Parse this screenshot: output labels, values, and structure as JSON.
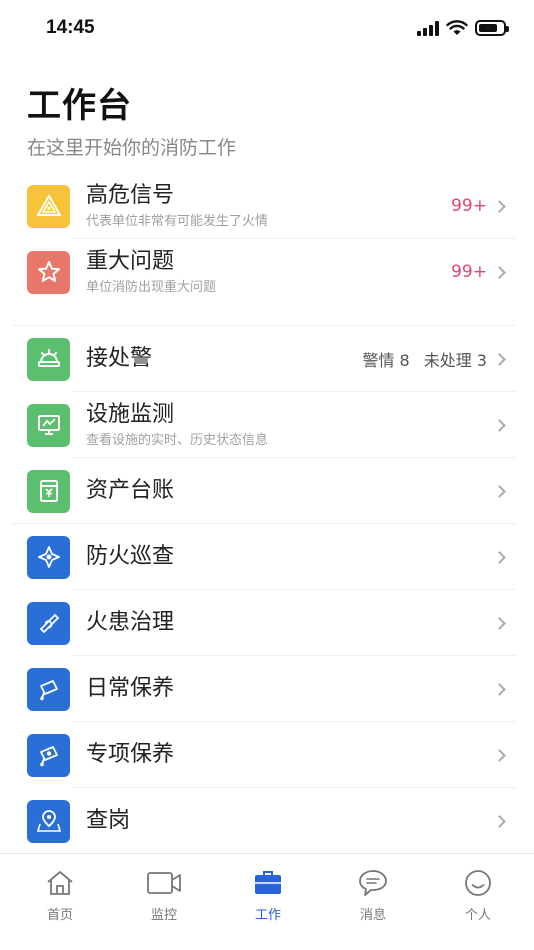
{
  "status_bar": {
    "time": "14:45"
  },
  "header": {
    "title": "工作台",
    "subtitle": "在这里开始你的消防工作"
  },
  "alerts": [
    {
      "label": "高危信号",
      "desc": "代表单位非常有可能发生了火情",
      "count": "99+",
      "icon": "warning-triangle-icon",
      "color": "#f7c33b"
    },
    {
      "label": "重大问题",
      "desc": "单位消防出现重大问题",
      "count": "99+",
      "icon": "star-icon",
      "color": "#e8776a"
    }
  ],
  "menu": [
    {
      "label": "接处警",
      "desc": "",
      "meta_a": "警情 8",
      "meta_b": "未处理 3",
      "icon": "alarm-bell-icon",
      "color": "#5bbf6f"
    },
    {
      "label": "设施监测",
      "desc": "查看设施的实时、历史状态信息",
      "icon": "monitor-icon",
      "color": "#5bbf6f"
    },
    {
      "label": "资产台账",
      "desc": "",
      "icon": "ledger-icon",
      "color": "#5bbf6f"
    },
    {
      "label": "防火巡查",
      "desc": "",
      "icon": "patrol-icon",
      "color": "#2a6fd6"
    },
    {
      "label": "火患治理",
      "desc": "",
      "icon": "fire-hazard-icon",
      "color": "#2a6fd6"
    },
    {
      "label": "日常保养",
      "desc": "",
      "icon": "daily-maintenance-icon",
      "color": "#2a6fd6"
    },
    {
      "label": "专项保养",
      "desc": "",
      "icon": "special-maintenance-icon",
      "color": "#2a6fd6"
    },
    {
      "label": "查岗",
      "desc": "",
      "icon": "map-pin-icon",
      "color": "#2a6fd6"
    }
  ],
  "tabbar": {
    "tabs": [
      {
        "label": "首页",
        "icon": "home-icon"
      },
      {
        "label": "监控",
        "icon": "video-camera-icon"
      },
      {
        "label": "工作",
        "icon": "briefcase-icon",
        "active": true
      },
      {
        "label": "消息",
        "icon": "chat-bubble-icon"
      },
      {
        "label": "个人",
        "icon": "smiley-icon"
      }
    ],
    "active_color": "#2962d9"
  }
}
